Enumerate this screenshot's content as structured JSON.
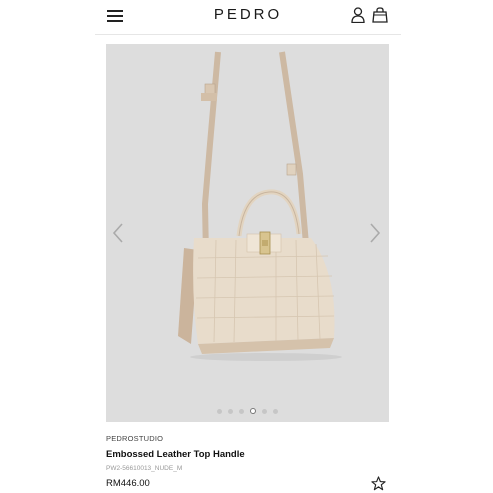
{
  "header": {
    "logo": "PEDRO",
    "icons": [
      "menu-icon",
      "user-icon",
      "shopping-bag-icon"
    ]
  },
  "gallery": {
    "image": "embossed-leather-top-handle-bag",
    "slide_count": 6,
    "active_index": 3,
    "background": "#dddddd"
  },
  "product": {
    "brand": "PEDROSTUDIO",
    "name": "Embossed Leather Top Handle",
    "sku": "PW2-56610013_NUDE_M",
    "price": "RM446.00",
    "color": "#e8dccb"
  },
  "actions": {
    "wishlist_icon": "star-icon"
  }
}
